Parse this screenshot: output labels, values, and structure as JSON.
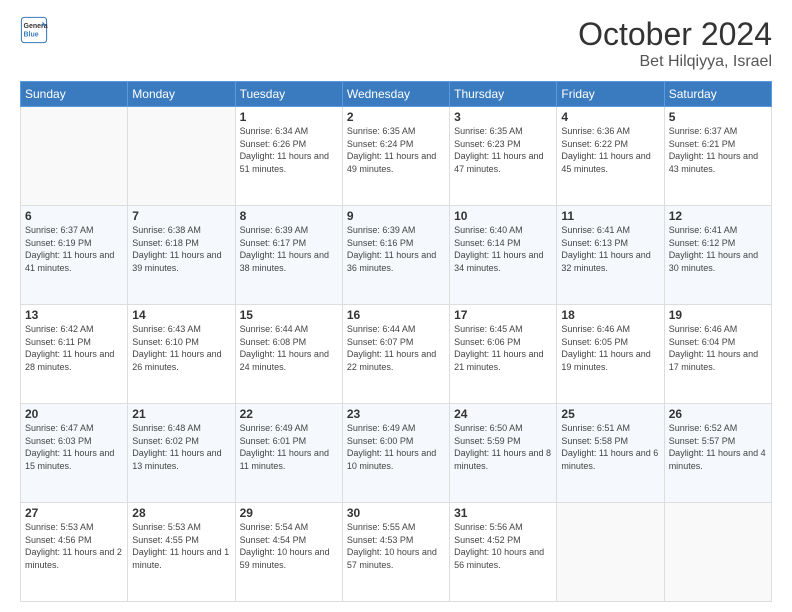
{
  "header": {
    "logo_line1": "General",
    "logo_line2": "Blue",
    "month": "October 2024",
    "location": "Bet Hilqiyya, Israel"
  },
  "days_of_week": [
    "Sunday",
    "Monday",
    "Tuesday",
    "Wednesday",
    "Thursday",
    "Friday",
    "Saturday"
  ],
  "weeks": [
    [
      {
        "day": "",
        "sunrise": "",
        "sunset": "",
        "daylight": ""
      },
      {
        "day": "",
        "sunrise": "",
        "sunset": "",
        "daylight": ""
      },
      {
        "day": "1",
        "sunrise": "Sunrise: 6:34 AM",
        "sunset": "Sunset: 6:26 PM",
        "daylight": "Daylight: 11 hours and 51 minutes."
      },
      {
        "day": "2",
        "sunrise": "Sunrise: 6:35 AM",
        "sunset": "Sunset: 6:24 PM",
        "daylight": "Daylight: 11 hours and 49 minutes."
      },
      {
        "day": "3",
        "sunrise": "Sunrise: 6:35 AM",
        "sunset": "Sunset: 6:23 PM",
        "daylight": "Daylight: 11 hours and 47 minutes."
      },
      {
        "day": "4",
        "sunrise": "Sunrise: 6:36 AM",
        "sunset": "Sunset: 6:22 PM",
        "daylight": "Daylight: 11 hours and 45 minutes."
      },
      {
        "day": "5",
        "sunrise": "Sunrise: 6:37 AM",
        "sunset": "Sunset: 6:21 PM",
        "daylight": "Daylight: 11 hours and 43 minutes."
      }
    ],
    [
      {
        "day": "6",
        "sunrise": "Sunrise: 6:37 AM",
        "sunset": "Sunset: 6:19 PM",
        "daylight": "Daylight: 11 hours and 41 minutes."
      },
      {
        "day": "7",
        "sunrise": "Sunrise: 6:38 AM",
        "sunset": "Sunset: 6:18 PM",
        "daylight": "Daylight: 11 hours and 39 minutes."
      },
      {
        "day": "8",
        "sunrise": "Sunrise: 6:39 AM",
        "sunset": "Sunset: 6:17 PM",
        "daylight": "Daylight: 11 hours and 38 minutes."
      },
      {
        "day": "9",
        "sunrise": "Sunrise: 6:39 AM",
        "sunset": "Sunset: 6:16 PM",
        "daylight": "Daylight: 11 hours and 36 minutes."
      },
      {
        "day": "10",
        "sunrise": "Sunrise: 6:40 AM",
        "sunset": "Sunset: 6:14 PM",
        "daylight": "Daylight: 11 hours and 34 minutes."
      },
      {
        "day": "11",
        "sunrise": "Sunrise: 6:41 AM",
        "sunset": "Sunset: 6:13 PM",
        "daylight": "Daylight: 11 hours and 32 minutes."
      },
      {
        "day": "12",
        "sunrise": "Sunrise: 6:41 AM",
        "sunset": "Sunset: 6:12 PM",
        "daylight": "Daylight: 11 hours and 30 minutes."
      }
    ],
    [
      {
        "day": "13",
        "sunrise": "Sunrise: 6:42 AM",
        "sunset": "Sunset: 6:11 PM",
        "daylight": "Daylight: 11 hours and 28 minutes."
      },
      {
        "day": "14",
        "sunrise": "Sunrise: 6:43 AM",
        "sunset": "Sunset: 6:10 PM",
        "daylight": "Daylight: 11 hours and 26 minutes."
      },
      {
        "day": "15",
        "sunrise": "Sunrise: 6:44 AM",
        "sunset": "Sunset: 6:08 PM",
        "daylight": "Daylight: 11 hours and 24 minutes."
      },
      {
        "day": "16",
        "sunrise": "Sunrise: 6:44 AM",
        "sunset": "Sunset: 6:07 PM",
        "daylight": "Daylight: 11 hours and 22 minutes."
      },
      {
        "day": "17",
        "sunrise": "Sunrise: 6:45 AM",
        "sunset": "Sunset: 6:06 PM",
        "daylight": "Daylight: 11 hours and 21 minutes."
      },
      {
        "day": "18",
        "sunrise": "Sunrise: 6:46 AM",
        "sunset": "Sunset: 6:05 PM",
        "daylight": "Daylight: 11 hours and 19 minutes."
      },
      {
        "day": "19",
        "sunrise": "Sunrise: 6:46 AM",
        "sunset": "Sunset: 6:04 PM",
        "daylight": "Daylight: 11 hours and 17 minutes."
      }
    ],
    [
      {
        "day": "20",
        "sunrise": "Sunrise: 6:47 AM",
        "sunset": "Sunset: 6:03 PM",
        "daylight": "Daylight: 11 hours and 15 minutes."
      },
      {
        "day": "21",
        "sunrise": "Sunrise: 6:48 AM",
        "sunset": "Sunset: 6:02 PM",
        "daylight": "Daylight: 11 hours and 13 minutes."
      },
      {
        "day": "22",
        "sunrise": "Sunrise: 6:49 AM",
        "sunset": "Sunset: 6:01 PM",
        "daylight": "Daylight: 11 hours and 11 minutes."
      },
      {
        "day": "23",
        "sunrise": "Sunrise: 6:49 AM",
        "sunset": "Sunset: 6:00 PM",
        "daylight": "Daylight: 11 hours and 10 minutes."
      },
      {
        "day": "24",
        "sunrise": "Sunrise: 6:50 AM",
        "sunset": "Sunset: 5:59 PM",
        "daylight": "Daylight: 11 hours and 8 minutes."
      },
      {
        "day": "25",
        "sunrise": "Sunrise: 6:51 AM",
        "sunset": "Sunset: 5:58 PM",
        "daylight": "Daylight: 11 hours and 6 minutes."
      },
      {
        "day": "26",
        "sunrise": "Sunrise: 6:52 AM",
        "sunset": "Sunset: 5:57 PM",
        "daylight": "Daylight: 11 hours and 4 minutes."
      }
    ],
    [
      {
        "day": "27",
        "sunrise": "Sunrise: 5:53 AM",
        "sunset": "Sunset: 4:56 PM",
        "daylight": "Daylight: 11 hours and 2 minutes."
      },
      {
        "day": "28",
        "sunrise": "Sunrise: 5:53 AM",
        "sunset": "Sunset: 4:55 PM",
        "daylight": "Daylight: 11 hours and 1 minute."
      },
      {
        "day": "29",
        "sunrise": "Sunrise: 5:54 AM",
        "sunset": "Sunset: 4:54 PM",
        "daylight": "Daylight: 10 hours and 59 minutes."
      },
      {
        "day": "30",
        "sunrise": "Sunrise: 5:55 AM",
        "sunset": "Sunset: 4:53 PM",
        "daylight": "Daylight: 10 hours and 57 minutes."
      },
      {
        "day": "31",
        "sunrise": "Sunrise: 5:56 AM",
        "sunset": "Sunset: 4:52 PM",
        "daylight": "Daylight: 10 hours and 56 minutes."
      },
      {
        "day": "",
        "sunrise": "",
        "sunset": "",
        "daylight": ""
      },
      {
        "day": "",
        "sunrise": "",
        "sunset": "",
        "daylight": ""
      }
    ]
  ]
}
